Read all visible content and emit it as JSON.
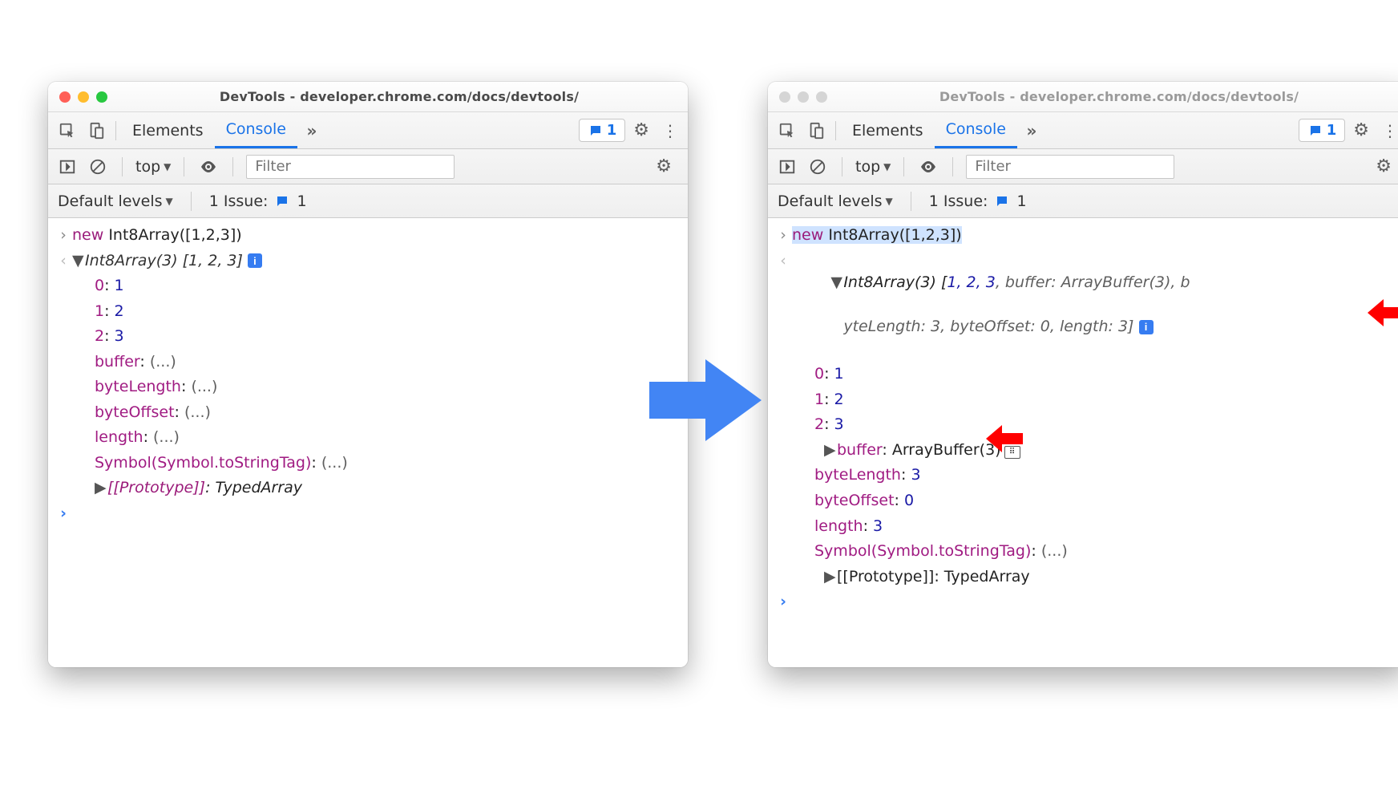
{
  "windowTitle": "DevTools - developer.chrome.com/docs/devtools/",
  "tabs": {
    "elements": "Elements",
    "console": "Console"
  },
  "issuesCount": "1",
  "context": "top",
  "filterPlaceholder": "Filter",
  "levels": "Default levels",
  "issueLabel": "1 Issue:",
  "issueBadge": "1",
  "input": {
    "kw": "new",
    "fn": "Int8Array",
    "args": "([1,2,3])"
  },
  "left": {
    "summary": "Int8Array(3) [1, 2, 3]",
    "entries": [
      {
        "k": "0",
        "v": "1"
      },
      {
        "k": "1",
        "v": "2"
      },
      {
        "k": "2",
        "v": "3"
      }
    ],
    "lazy": [
      "buffer",
      "byteLength",
      "byteOffset",
      "length",
      "Symbol(Symbol.toStringTag)"
    ],
    "proto": {
      "k": "[[Prototype]]",
      "v": "TypedArray"
    },
    "ellipsis": "(...)"
  },
  "right": {
    "summaryLine1a": "Int8Array(3) [",
    "summaryLine1b": "1, 2, 3",
    "summaryLine1c": ", buffer: ArrayBuffer(3), b",
    "summaryLine2": "yteLength: 3, byteOffset: 0, length: 3]",
    "entries": [
      {
        "k": "0",
        "v": "1"
      },
      {
        "k": "1",
        "v": "2"
      },
      {
        "k": "2",
        "v": "3"
      }
    ],
    "buffer": {
      "k": "buffer",
      "v": "ArrayBuffer(3)"
    },
    "props": [
      {
        "k": "byteLength",
        "v": "3"
      },
      {
        "k": "byteOffset",
        "v": "0"
      },
      {
        "k": "length",
        "v": "3"
      }
    ],
    "symbol": {
      "k": "Symbol(Symbol.toStringTag)",
      "v": "(...)"
    },
    "proto": {
      "k": "[[Prototype]]",
      "v": "TypedArray"
    }
  }
}
